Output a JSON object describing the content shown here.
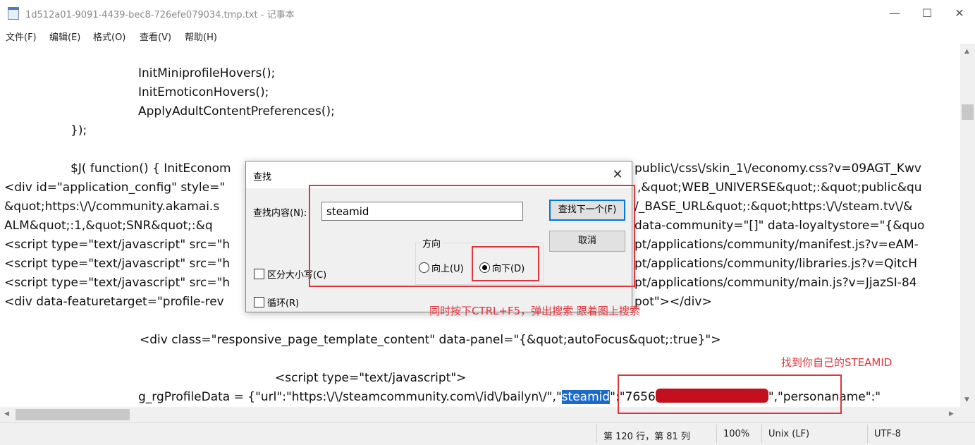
{
  "window": {
    "title": "1d512a01-9091-4439-bec8-726efe079034.tmp.txt - 记事本",
    "minimize": "—",
    "maximize": "☐",
    "close": "✕"
  },
  "menu": [
    "文件(F)",
    "编辑(E)",
    "格式(O)",
    "查看(V)",
    "帮助(H)"
  ],
  "editor": {
    "lines": [
      "InitMiniprofileHovers();",
      "InitEmoticonHovers();",
      "ApplyAdultContentPreferences();",
      "});",
      "$J( function() { InitEconom",
      "<div id=\"application_config\" style=\"",
      "&quot;https:\\/\\/community.akamai.s",
      "ALM&quot;:1,&quot;SNR&quot;:&q",
      "<script type=\"text/javascript\" src=\"h",
      "<script type=\"text/javascript\" src=\"h",
      "<script type=\"text/javascript\" src=\"h",
      "<div data-featuretarget=\"profile-rev",
      "<div class=\"responsive_page_template_content\" data-panel=\"{&quot;autoFocus&quot;:true}\">",
      "<script type=\"text/javascript\">",
      "g_rgProfileData = {\"url\":\"https:\\/\\/steamcommunity.com\\/id\\/bailyn\\/\",\"",
      "steamid",
      "\":\"7656",
      "\",\"personaname\":\""
    ],
    "right_parts": [
      "public\\/css\\/skin_1\\/economy.css?v=09AGT_Kwv",
      ",&quot;WEB_UNIVERSE&quot;:&quot;public&qu",
      "/_BASE_URL&quot;:&quot;https:\\/\\/steam.tv\\/&",
      "data-community=\"[]\" data-loyaltystore=\"{&quo",
      "pt/applications/community/manifest.js?v=eAM-",
      "pt/applications/community/libraries.js?v=QitcH",
      "pt/applications/community/main.js?v=JjazSI-84",
      "pot\"></div>"
    ]
  },
  "status": {
    "position": "第 120 行，第 81 列",
    "zoom": "100%",
    "eol": "Unix (LF)",
    "encoding": "UTF-8"
  },
  "dialog": {
    "title": "查找",
    "find_label": "查找内容(N):",
    "find_value": "steamid",
    "find_next": "查找下一个(F)",
    "cancel": "取消",
    "direction_label": "方向",
    "up_label": "向上(U)",
    "down_label": "向下(D)",
    "match_case": "区分大小写(C)",
    "wrap": "循环(R)"
  },
  "annotations": {
    "note1": "同时按下CTRL+F5，弹出搜索 跟着图上搜索",
    "note2": "找到你自己的STEAMID"
  },
  "colors": {
    "accent": "#0078d7",
    "annotation": "#e0353b",
    "selection": "#1b6ac9"
  }
}
